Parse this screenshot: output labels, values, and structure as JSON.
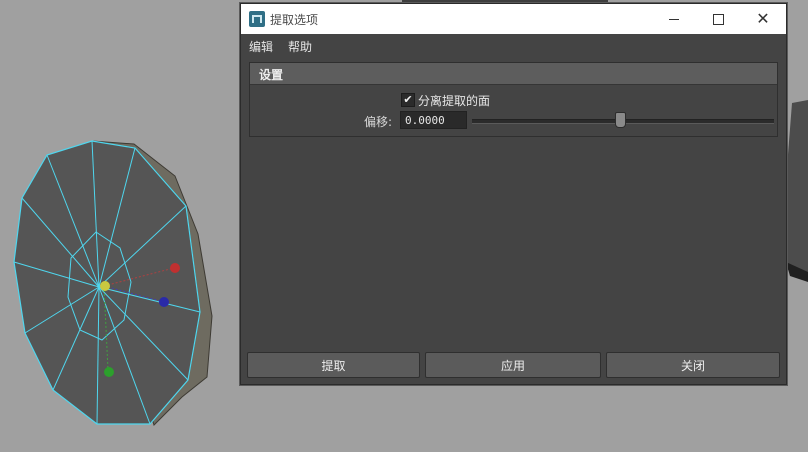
{
  "window": {
    "title": "提取选项",
    "minimize_icon": "minimize-icon",
    "maximize_icon": "maximize-icon",
    "close_icon": "close-icon"
  },
  "menu": {
    "edit": "编辑",
    "help": "帮助"
  },
  "settings": {
    "header": "设置",
    "separate_faces_label": "分离提取的面",
    "separate_faces_checked": true,
    "offset_label": "偏移:",
    "offset_value": "0.0000",
    "offset_slider_fraction": 0.49
  },
  "buttons": {
    "extract": "提取",
    "apply": "应用",
    "close": "关闭"
  },
  "colors": {
    "wireframe": "#4fd6ee",
    "mesh_face": "#555555",
    "dialog_bg": "#444444"
  }
}
